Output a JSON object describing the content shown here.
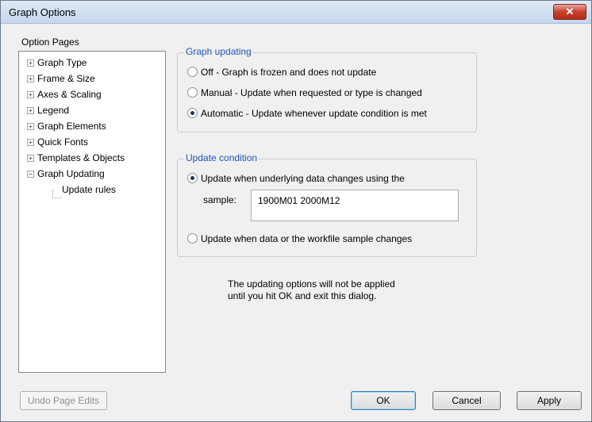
{
  "window": {
    "title": "Graph Options",
    "close_label": "✕"
  },
  "sidebar": {
    "label": "Option Pages",
    "items": [
      {
        "label": "Graph Type",
        "expander": "+"
      },
      {
        "label": "Frame & Size",
        "expander": "+"
      },
      {
        "label": "Axes & Scaling",
        "expander": "+"
      },
      {
        "label": "Legend",
        "expander": "+"
      },
      {
        "label": "Graph Elements",
        "expander": "+"
      },
      {
        "label": "Quick Fonts",
        "expander": "+"
      },
      {
        "label": "Templates & Objects",
        "expander": "+"
      },
      {
        "label": "Graph Updating",
        "expander": "−"
      }
    ],
    "child": {
      "label": "Update rules"
    }
  },
  "graph_updating": {
    "title": "Graph updating",
    "options": [
      {
        "label": "Off - Graph is frozen and does not update",
        "selected": false
      },
      {
        "label": "Manual - Update when requested or type is changed",
        "selected": false
      },
      {
        "label": "Automatic - Update whenever update condition is met",
        "selected": true
      }
    ]
  },
  "update_condition": {
    "title": "Update condition",
    "option1": {
      "label": "Update when underlying data changes using the",
      "selected": true
    },
    "sample_label": "sample:",
    "sample_value": "1900M01 2000M12",
    "option2": {
      "label": "Update when data or the workfile sample changes",
      "selected": false
    }
  },
  "note": {
    "line1": "The updating options will not be applied",
    "line2": "until you hit OK and exit this dialog."
  },
  "buttons": {
    "undo": "Undo Page Edits",
    "ok": "OK",
    "cancel": "Cancel",
    "apply": "Apply"
  }
}
